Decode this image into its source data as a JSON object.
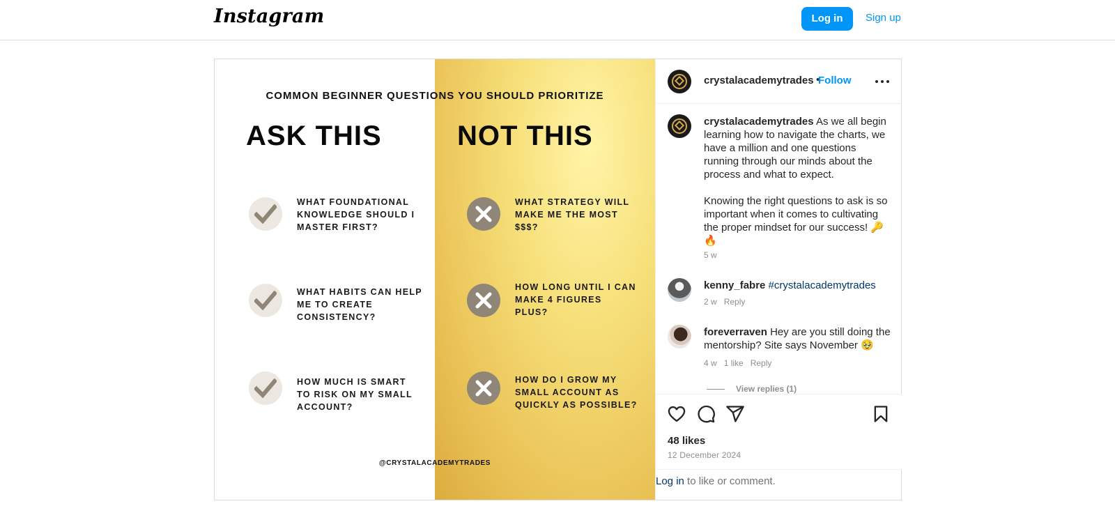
{
  "header": {
    "logo": "Instagram",
    "login_label": "Log in",
    "signup_label": "Sign up"
  },
  "post_image": {
    "heading": "COMMON BEGINNER QUESTIONS YOU SHOULD PRIORITIZE",
    "ask_title": "ASK THIS",
    "not_title": "NOT THIS",
    "ask_items": [
      "WHAT FOUNDATIONAL KNOWLEDGE SHOULD I MASTER FIRST?",
      "WHAT HABITS CAN HELP ME TO CREATE CONSISTENCY?",
      "HOW MUCH IS SMART TO RISK ON MY SMALL ACCOUNT?"
    ],
    "not_items": [
      "WHAT STRATEGY WILL MAKE ME THE MOST $$$?",
      "HOW LONG UNTIL I CAN MAKE 4 FIGURES PLUS?",
      "HOW DO I GROW MY SMALL ACCOUNT AS QUICKLY AS POSSIBLE?"
    ],
    "handle": "@CRYSTALACADEMYTRADES"
  },
  "panel": {
    "username": "crystalacademytrades",
    "dot": "•",
    "follow_label": "Follow",
    "caption_user": "crystalacademytrades",
    "caption_p1": "As we all begin learning how to navigate the charts, we have a million and one questions running through our minds about the process and what to expect.",
    "caption_p2": "Knowing the right questions to ask is so important when it comes to cultivating the proper mindset for our success! 🔑 🔥",
    "caption_age": "5 w",
    "comments": [
      {
        "user": "kenny_fabre",
        "text": "#crystalacademytrades",
        "age": "2 w",
        "likes": "",
        "reply": "Reply"
      },
      {
        "user": "foreverraven",
        "text": "Hey are you still doing the mentorship? Site says November 🥹",
        "age": "4 w",
        "likes": "1 like",
        "reply": "Reply"
      }
    ],
    "view_replies": "View replies (1)",
    "likes": "48 likes",
    "date": "12 December 2024",
    "login_link": "Log in",
    "login_rest": " to like or comment."
  },
  "icons": {
    "like": "heart-icon",
    "comment": "comment-icon",
    "share": "share-icon",
    "save": "bookmark-icon",
    "more": "more-icon"
  },
  "colors": {
    "accent": "#0095f6",
    "gold": "#ebc55a",
    "check_bg": "#ece8e1",
    "x_bg": "#8f8677"
  }
}
